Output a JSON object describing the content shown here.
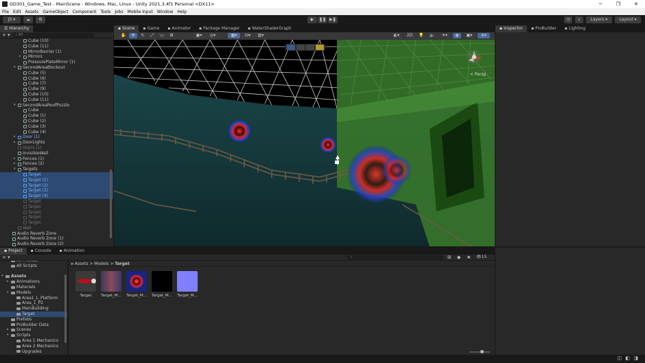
{
  "window": {
    "title": "GD301_Game_Test - MainScene - Windows, Mac, Linux - Unity 2021.3.4f1 Personal <DX11>"
  },
  "menu": [
    "File",
    "Edit",
    "Assets",
    "GameObject",
    "Component",
    "Tools",
    "Jobs",
    "Mobile Input",
    "Window",
    "Help"
  ],
  "toolbar": {
    "account": "JS",
    "layers": "Layers",
    "layout": "Layout"
  },
  "hierarchy": {
    "tab": "Hierarchy",
    "search": "All",
    "rows": [
      {
        "label": "Cube (10)",
        "indent": 3,
        "style": ""
      },
      {
        "label": "Cube (11)",
        "indent": 3,
        "style": ""
      },
      {
        "label": "MirrorBarrier (1)",
        "indent": 3,
        "style": ""
      },
      {
        "label": "Mirrors",
        "indent": 3,
        "style": "",
        "arrow": "▸"
      },
      {
        "label": "PressurePlateMirror (1)",
        "indent": 3,
        "style": ""
      },
      {
        "label": "SecondAreaBlockout",
        "indent": 2,
        "style": "",
        "arrow": "▾"
      },
      {
        "label": "Cube (5)",
        "indent": 3,
        "style": ""
      },
      {
        "label": "Cube (6)",
        "indent": 3,
        "style": ""
      },
      {
        "label": "Cube (7)",
        "indent": 3,
        "style": ""
      },
      {
        "label": "Cube (9)",
        "indent": 3,
        "style": ""
      },
      {
        "label": "Cube (10)",
        "indent": 3,
        "style": ""
      },
      {
        "label": "Cube (11)",
        "indent": 3,
        "style": ""
      },
      {
        "label": "SecondAreaRoofPuzzle",
        "indent": 2,
        "style": "",
        "arrow": "▾"
      },
      {
        "label": "Cube",
        "indent": 3,
        "style": ""
      },
      {
        "label": "Cube (1)",
        "indent": 3,
        "style": ""
      },
      {
        "label": "Cube (2)",
        "indent": 3,
        "style": ""
      },
      {
        "label": "Cube (3)",
        "indent": 3,
        "style": ""
      },
      {
        "label": "Cube (4)",
        "indent": 3,
        "style": ""
      },
      {
        "label": "Door (1)",
        "indent": 2,
        "style": "blue",
        "arrow": "▸"
      },
      {
        "label": "DoorLights",
        "indent": 2,
        "style": "",
        "arrow": "▸"
      },
      {
        "label": "Stairs (1)",
        "indent": 2,
        "style": "dim"
      },
      {
        "label": "InvisibleWall",
        "indent": 2,
        "style": ""
      },
      {
        "label": "Fences (1)",
        "indent": 2,
        "style": "",
        "arrow": "▸"
      },
      {
        "label": "Fences (2)",
        "indent": 2,
        "style": "",
        "arrow": "▸"
      },
      {
        "label": "Targets",
        "indent": 2,
        "style": "",
        "arrow": "▾"
      },
      {
        "label": "Target",
        "indent": 3,
        "style": "blue selected"
      },
      {
        "label": "Target (1)",
        "indent": 3,
        "style": "blue selected"
      },
      {
        "label": "Target (2)",
        "indent": 3,
        "style": "blue selected"
      },
      {
        "label": "Target (3)",
        "indent": 3,
        "style": "blue selected"
      },
      {
        "label": "Target (4)",
        "indent": 3,
        "style": "blue selected"
      },
      {
        "label": "Target",
        "indent": 3,
        "style": "dim"
      },
      {
        "label": "Target",
        "indent": 3,
        "style": "dim"
      },
      {
        "label": "Target",
        "indent": 3,
        "style": "dim"
      },
      {
        "label": "Target",
        "indent": 3,
        "style": "dim"
      },
      {
        "label": "Target",
        "indent": 3,
        "style": "dim"
      },
      {
        "label": "Wall",
        "indent": 2,
        "style": "dim"
      },
      {
        "label": "Audio Reverb Zone",
        "indent": 1,
        "style": ""
      },
      {
        "label": "Audio Reverb Zone (1)",
        "indent": 1,
        "style": ""
      },
      {
        "label": "Audio Reverb Zone (2)",
        "indent": 1,
        "style": ""
      }
    ]
  },
  "scene": {
    "tabs": [
      {
        "label": "Scene",
        "icon": "scene-icon"
      },
      {
        "label": "Game",
        "icon": "game-icon"
      },
      {
        "label": "Animator",
        "icon": "animator-icon"
      },
      {
        "label": "Package Manager",
        "icon": "package-icon"
      },
      {
        "label": "WaterShaderGraph",
        "icon": "shadergraph-icon"
      }
    ],
    "persp_label": "< Persp",
    "mode_2d": "2D"
  },
  "inspector": {
    "tabs": [
      {
        "label": "Inspector"
      },
      {
        "label": "ProBuilder"
      },
      {
        "label": "Lighting"
      }
    ]
  },
  "bottom": {
    "tabs": [
      {
        "label": "Project"
      },
      {
        "label": "Console"
      },
      {
        "label": "Animation"
      }
    ],
    "hidden_count": "15",
    "tree": [
      {
        "label": "All Prefabs",
        "indent": 1,
        "style": ""
      },
      {
        "label": "All Scripts",
        "indent": 1,
        "style": ""
      },
      {
        "label": "",
        "indent": 0,
        "style": ""
      },
      {
        "label": "Assets",
        "indent": 0,
        "style": "bold",
        "arrow": "▾"
      },
      {
        "label": "Animations",
        "indent": 1,
        "style": "",
        "arrow": "▸"
      },
      {
        "label": "Materials",
        "indent": 1,
        "style": ""
      },
      {
        "label": "Models",
        "indent": 1,
        "style": "",
        "arrow": "▾"
      },
      {
        "label": "Area1_L_Platform",
        "indent": 2,
        "style": ""
      },
      {
        "label": "Area_1_P2",
        "indent": 2,
        "style": ""
      },
      {
        "label": "MainBuilding",
        "indent": 2,
        "style": ""
      },
      {
        "label": "Target",
        "indent": 2,
        "style": "selected"
      },
      {
        "label": "Prefabs",
        "indent": 1,
        "style": ""
      },
      {
        "label": "ProBuilder Data",
        "indent": 1,
        "style": ""
      },
      {
        "label": "Scenes",
        "indent": 1,
        "style": "",
        "arrow": "▸"
      },
      {
        "label": "Scripts",
        "indent": 1,
        "style": "",
        "arrow": "▾"
      },
      {
        "label": "Area 1 Mechanics",
        "indent": 2,
        "style": ""
      },
      {
        "label": "Area 2 Mechanics",
        "indent": 2,
        "style": ""
      },
      {
        "label": "Upgrades",
        "indent": 2,
        "style": ""
      }
    ],
    "breadcrumb": [
      "Assets",
      "Models",
      "Target"
    ],
    "assets": [
      {
        "label": "Target",
        "color": "#b3121a"
      },
      {
        "label": "Target_M...",
        "color": "#7c4a5a"
      },
      {
        "label": "Target_M...",
        "color": "#1a237e"
      },
      {
        "label": "Target_M...",
        "color": "#000000"
      },
      {
        "label": "Target_M...",
        "color": "#8080ff"
      }
    ]
  }
}
